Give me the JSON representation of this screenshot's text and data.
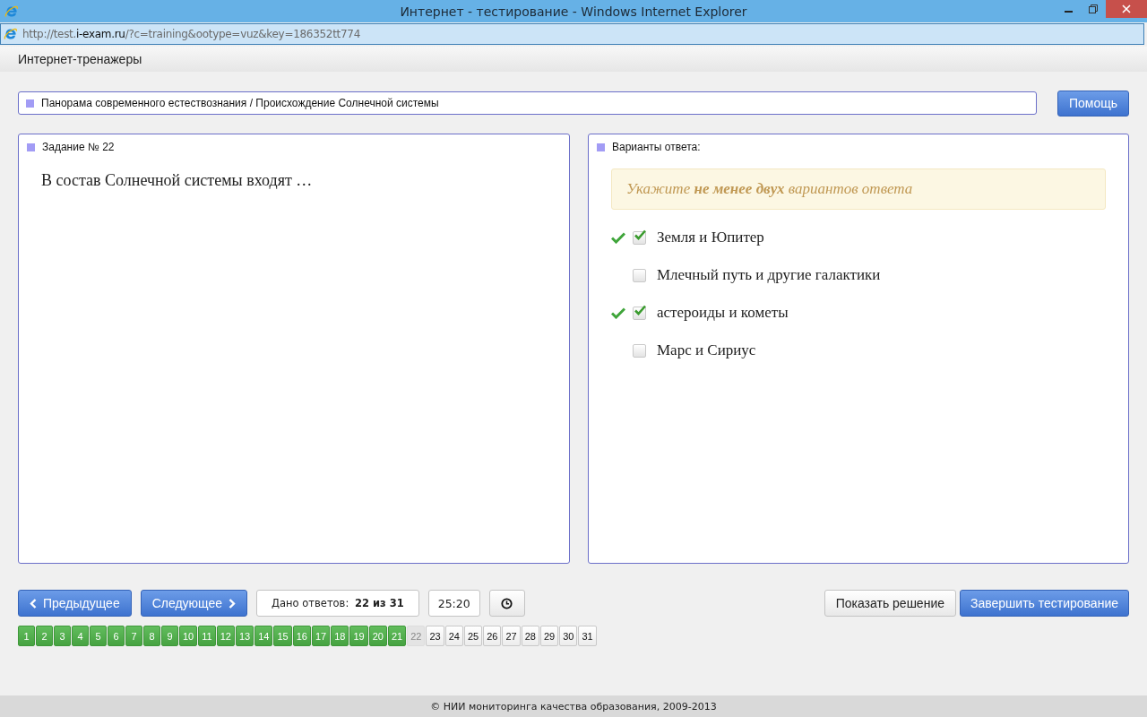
{
  "window": {
    "title": "Интернет - тестирование - Windows Internet Explorer"
  },
  "address_bar": {
    "url_prefix": "http://test.",
    "url_domain": "i-exam.ru",
    "url_rest": "/?c=training&ootype=vuz&key=186352tt774"
  },
  "app_header": {
    "title": "Интернет-тренажеры"
  },
  "breadcrumb": "Панорама современного естествознания / Происхождение Солнечной системы",
  "help_button": "Помощь",
  "task_panel": {
    "title": "Задание № 22",
    "question": "В состав Солнечной системы входят …"
  },
  "answers_panel": {
    "title": "Варианты ответа:",
    "hint": "Укажите **не менее двух** вариантов ответа",
    "options": [
      {
        "label": "Земля и Юпитер",
        "checked": true,
        "verified": true
      },
      {
        "label": "Млечный путь и другие галактики",
        "checked": false,
        "verified": false
      },
      {
        "label": "астероиды и кометы",
        "checked": true,
        "verified": true
      },
      {
        "label": "Марс и Сириус",
        "checked": false,
        "verified": false
      }
    ]
  },
  "nav": {
    "prev": "Предыдущее",
    "next": "Следующее",
    "answered_count": "Дано ответов: **22 из 31**",
    "timer": "25:20",
    "show_solution": "Показать решение",
    "finish": "Завершить тестирование"
  },
  "pages": [
    {
      "label": "1",
      "answered": true,
      "selected": false
    },
    {
      "label": "2",
      "answered": true,
      "selected": false
    },
    {
      "label": "3",
      "answered": true,
      "selected": false
    },
    {
      "label": "4",
      "answered": true,
      "selected": false
    },
    {
      "label": "5",
      "answered": true,
      "selected": false
    },
    {
      "label": "6",
      "answered": true,
      "selected": false
    },
    {
      "label": "7",
      "answered": true,
      "selected": false
    },
    {
      "label": "8",
      "answered": true,
      "selected": false
    },
    {
      "label": "9",
      "answered": true,
      "selected": false
    },
    {
      "label": "10",
      "answered": true,
      "selected": false
    },
    {
      "label": "11",
      "answered": true,
      "selected": false
    },
    {
      "label": "12",
      "answered": true,
      "selected": false
    },
    {
      "label": "13",
      "answered": true,
      "selected": false
    },
    {
      "label": "14",
      "answered": true,
      "selected": false
    },
    {
      "label": "15",
      "answered": true,
      "selected": false
    },
    {
      "label": "16",
      "answered": true,
      "selected": false
    },
    {
      "label": "17",
      "answered": true,
      "selected": false
    },
    {
      "label": "18",
      "answered": true,
      "selected": false
    },
    {
      "label": "19",
      "answered": true,
      "selected": false
    },
    {
      "label": "20",
      "answered": true,
      "selected": false
    },
    {
      "label": "21",
      "answered": true,
      "selected": false
    },
    {
      "label": "22",
      "answered": false,
      "selected": true
    },
    {
      "label": "23",
      "answered": false,
      "selected": false
    },
    {
      "label": "24",
      "answered": false,
      "selected": false
    },
    {
      "label": "25",
      "answered": false,
      "selected": false
    },
    {
      "label": "26",
      "answered": false,
      "selected": false
    },
    {
      "label": "27",
      "answered": false,
      "selected": false
    },
    {
      "label": "28",
      "answered": false,
      "selected": false
    },
    {
      "label": "29",
      "answered": false,
      "selected": false
    },
    {
      "label": "30",
      "answered": false,
      "selected": false
    },
    {
      "label": "31",
      "answered": false,
      "selected": false
    }
  ],
  "footer": "© НИИ мониторинга качества образования, 2009-2013"
}
